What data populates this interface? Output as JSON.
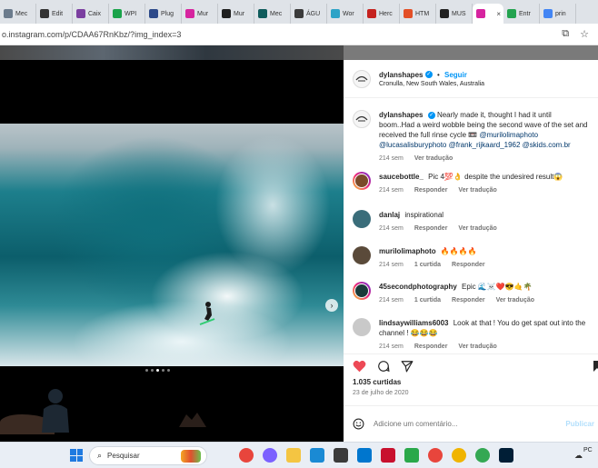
{
  "browser": {
    "tabs": [
      {
        "label": "Mec",
        "color": "#6b7b8c"
      },
      {
        "label": "Edit",
        "color": "#333333"
      },
      {
        "label": "Caix",
        "color": "#7b3fa0"
      },
      {
        "label": "WPI",
        "color": "#1aa34a"
      },
      {
        "label": "Plug",
        "color": "#2d4a8a"
      },
      {
        "label": "Mur",
        "color": "#d6249f"
      },
      {
        "label": "Mur",
        "color": "#1f1f1f"
      },
      {
        "label": "Mec",
        "color": "#0f5c5c"
      },
      {
        "label": "ÁGU",
        "color": "#3b3b3b"
      },
      {
        "label": "Wor",
        "color": "#2ea3c7"
      },
      {
        "label": "Herc",
        "color": "#c5221f"
      },
      {
        "label": "HTM",
        "color": "#e34f26"
      },
      {
        "label": "MUS",
        "color": "#222222"
      },
      {
        "label": "",
        "color": "#d6249f",
        "close": "×"
      },
      {
        "label": "Entr",
        "color": "#23a34f"
      },
      {
        "label": "prin",
        "color": "#4285f4"
      }
    ],
    "url": "o.instagram.com/p/CDAA67RnKbz/?img_index=3"
  },
  "post": {
    "author": "dylanshapes",
    "follow_label": "Seguir",
    "dot": "•",
    "location": "Cronulla, New South Wales, Australia",
    "caption": {
      "text": "Nearly made it, thought I had it until boom..Had a weird wobble being the second wave of the set and received the full rinse cycle 📼",
      "mentions": "@murilolimaphoto @lucasalisburyphoto @frank_rijkaard_1962 @skids.com.br",
      "time": "214 sem",
      "translate": "Ver tradução"
    },
    "comments": [
      {
        "user": "saucebottle_",
        "text": "Pic 4💯👌 despite the undesired result😱",
        "time": "214 sem",
        "reply": "Responder",
        "translate": "Ver tradução"
      },
      {
        "user": "danlaj",
        "text": "inspirational",
        "time": "214 sem",
        "reply": "Responder",
        "translate": "Ver tradução"
      },
      {
        "user": "murilolimaphoto",
        "text": "🔥🔥🔥🔥",
        "time": "214 sem",
        "likes": "1 curtida",
        "reply": "Responder"
      },
      {
        "user": "45secondphotography",
        "text": "Epic 🌊☠️❤️😎🤙🌴",
        "time": "214 sem",
        "likes": "1 curtida",
        "reply": "Responder",
        "translate": "Ver tradução"
      },
      {
        "user": "lindsaywilliams6003",
        "text": "Look at that ! You do get spat out into the channel ! 😂😂😂",
        "time": "214 sem",
        "reply": "Responder",
        "translate": "Ver tradução"
      }
    ],
    "likes": "1.035 curtidas",
    "date": "23 de julho de 2020",
    "comment_placeholder": "Adicione um comentário...",
    "publish_label": "Publicar"
  },
  "taskbar": {
    "search_label": "Pesquisar",
    "apps": [
      {
        "name": "chrome",
        "color": "#e8453c"
      },
      {
        "name": "copilot",
        "color": "#7b61ff"
      },
      {
        "name": "file-explorer",
        "color": "#f4c542"
      },
      {
        "name": "edge",
        "color": "#1a8ad4"
      },
      {
        "name": "store",
        "color": "#3b3b3b"
      },
      {
        "name": "dell",
        "color": "#0076ce"
      },
      {
        "name": "mcafee",
        "color": "#c8102e"
      },
      {
        "name": "notepad",
        "color": "#2aa84a"
      },
      {
        "name": "chrome-2",
        "color": "#e8453c"
      },
      {
        "name": "chrome-3",
        "color": "#f0b400"
      },
      {
        "name": "chrome-4",
        "color": "#34a853"
      },
      {
        "name": "photoshop",
        "color": "#001e36"
      }
    ],
    "tray_text": "PC"
  }
}
